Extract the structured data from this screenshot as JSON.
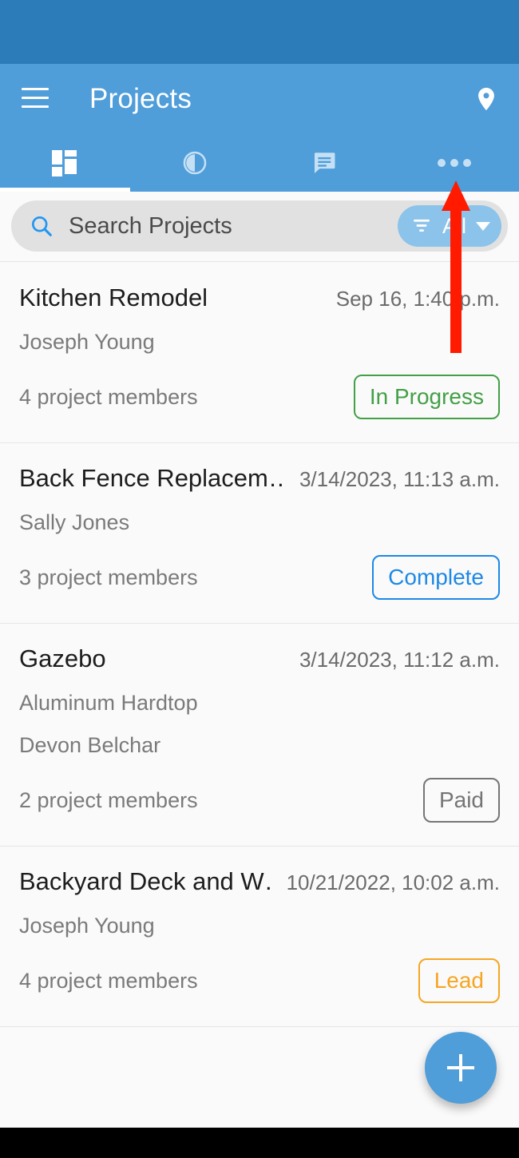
{
  "app_bar": {
    "title": "Projects",
    "menu_icon": "hamburger-menu-icon",
    "action_icon": "location-pin-icon"
  },
  "tabs": [
    {
      "icon": "dashboard-grid-icon",
      "label": "",
      "active": true
    },
    {
      "icon": "clock-pie-icon",
      "label": "",
      "active": false
    },
    {
      "icon": "chat-bubble-icon",
      "label": "",
      "active": false
    },
    {
      "icon": "overflow-dots-icon",
      "label": "",
      "active": false
    }
  ],
  "search": {
    "placeholder": "Search Projects",
    "value": "",
    "icon": "search-icon",
    "filter": {
      "icon": "filter-funnel-icon",
      "label": "All",
      "caret": "chevron-down-icon"
    }
  },
  "projects": [
    {
      "title": "Kitchen Remodel",
      "date": "Sep 16, 1:40 p.m.",
      "subtitle": "",
      "owner": "Joseph Young",
      "members": "4 project members",
      "status": "In Progress",
      "status_color": "#43a047"
    },
    {
      "title": "Back Fence Replacem…",
      "date": "3/14/2023, 11:13 a.m.",
      "subtitle": "",
      "owner": "Sally Jones",
      "members": "3 project members",
      "status": "Complete",
      "status_color": "#1e88e5"
    },
    {
      "title": "Gazebo",
      "date": "3/14/2023, 11:12 a.m.",
      "subtitle": "Aluminum Hardtop",
      "owner": "Devon Belchar",
      "members": "2 project members",
      "status": "Paid",
      "status_color": "#757575"
    },
    {
      "title": "Backyard Deck and W…",
      "date": "10/21/2022, 10:02 a.m.",
      "subtitle": "",
      "owner": "Joseph Young",
      "members": "4 project members",
      "status": "Lead",
      "status_color": "#f5a623"
    }
  ],
  "fab": {
    "icon": "plus-icon",
    "label": "+"
  },
  "annotation": {
    "arrow_color": "#ff1a00",
    "points_at": "overflow-dots-icon"
  },
  "colors": {
    "status_bar": "#2b7cb8",
    "app_bar": "#4f9dd9",
    "accent": "#4f9dd9",
    "page_background": "#fafafa",
    "search_field": "#e1e1e1",
    "filter_pill": "#8cc3ea"
  }
}
